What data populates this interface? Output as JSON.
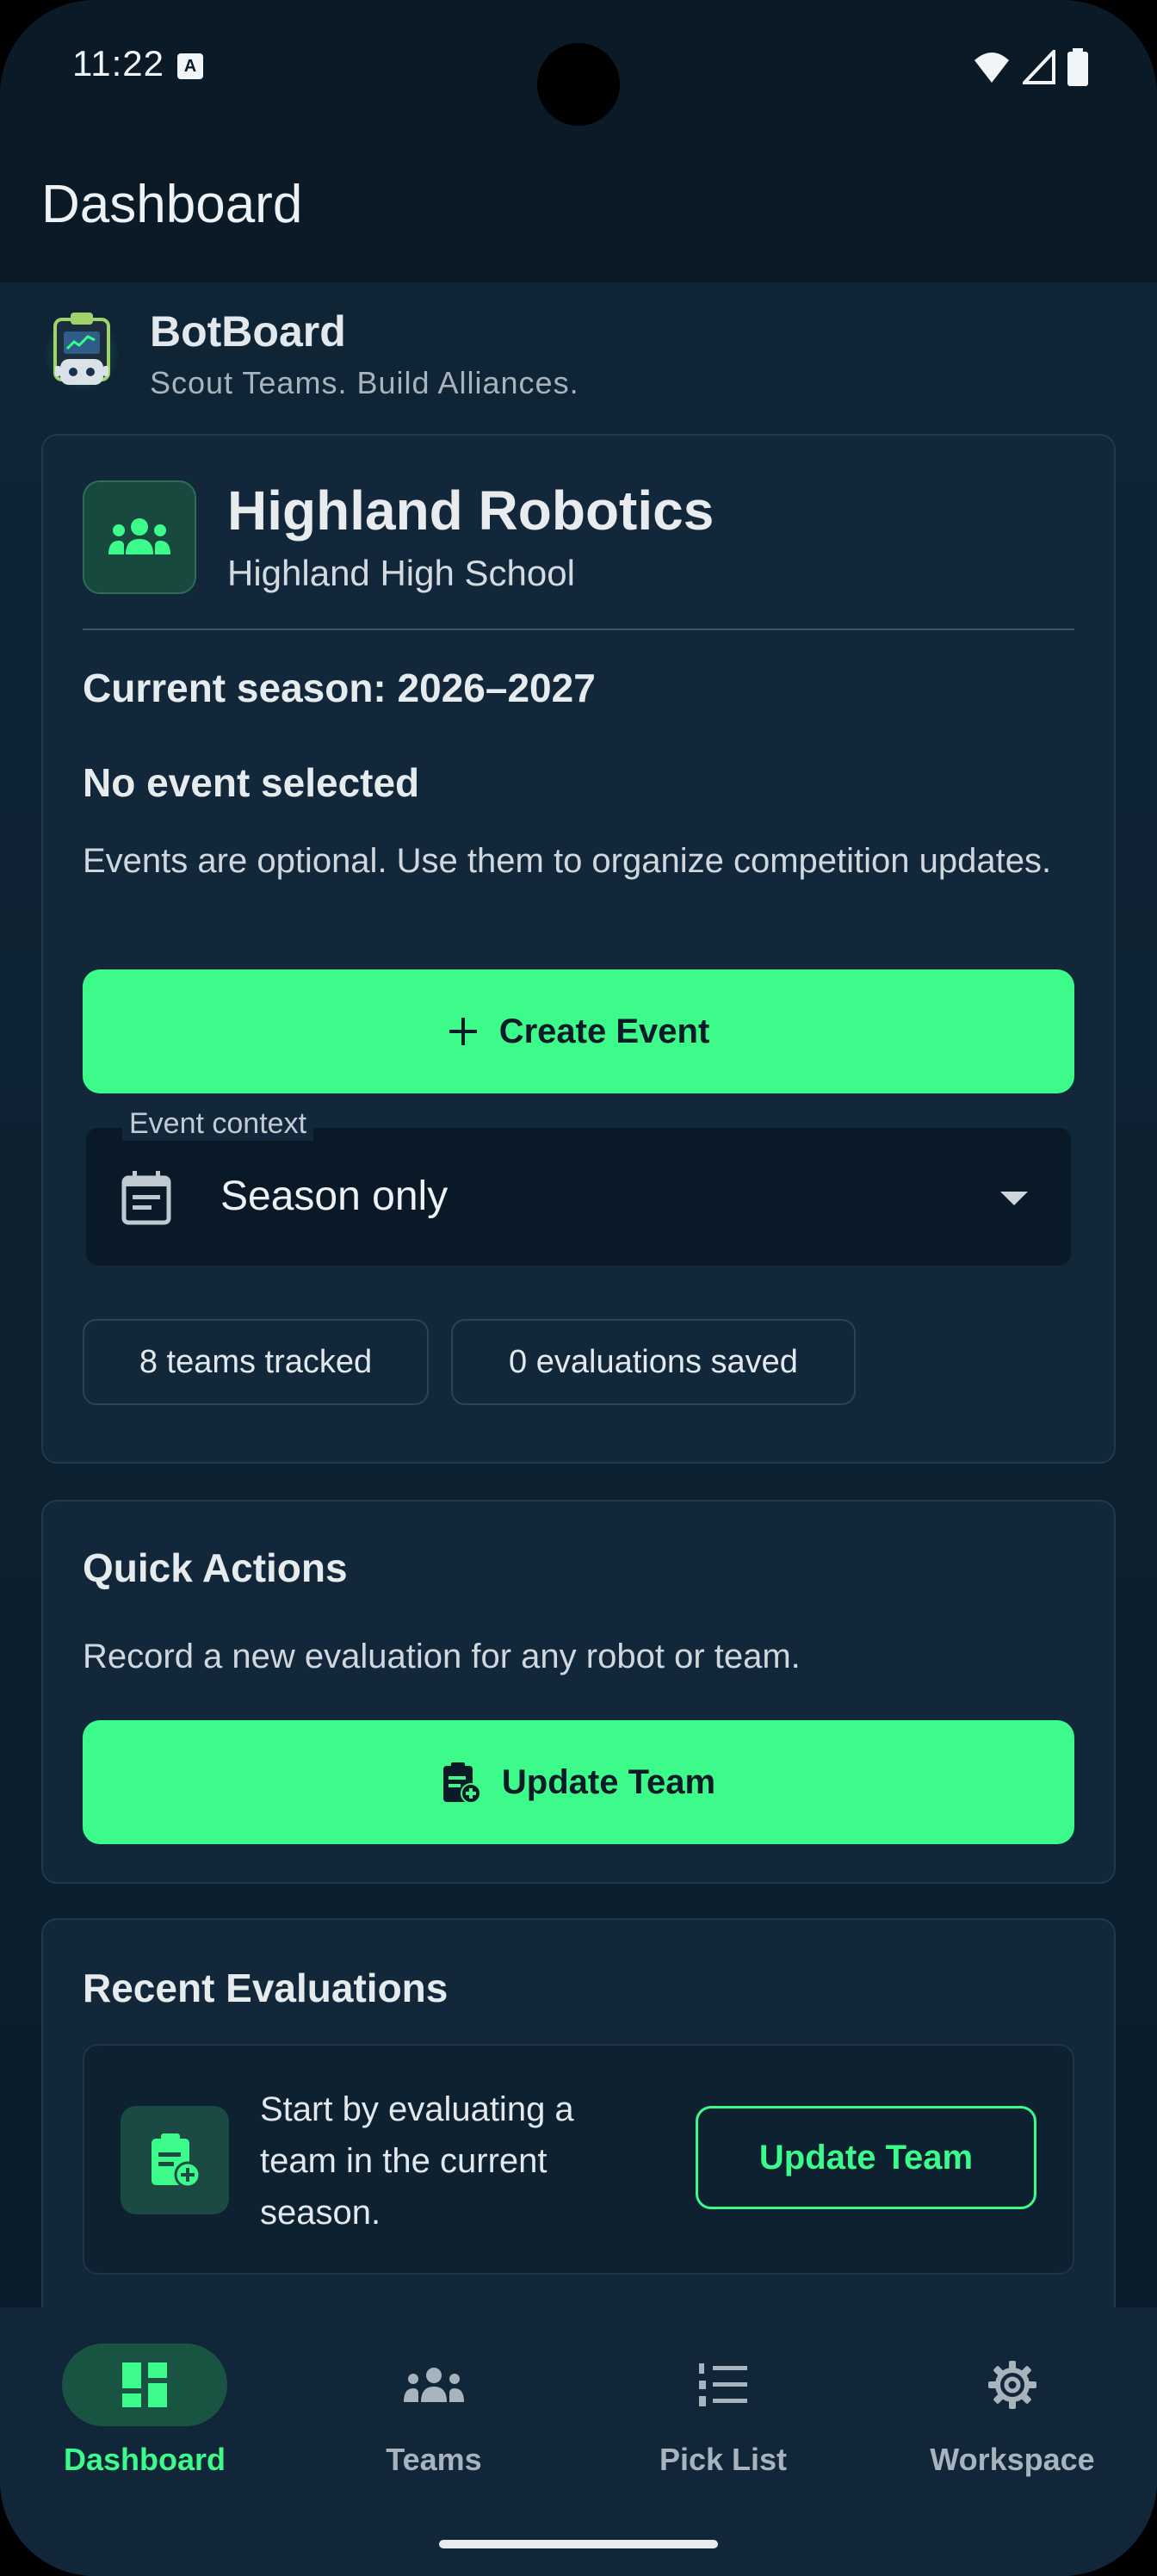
{
  "status_bar": {
    "time": "11:22",
    "indicator": "A"
  },
  "app_bar": {
    "title": "Dashboard"
  },
  "brand": {
    "name": "BotBoard",
    "tagline": "Scout Teams. Build Alliances."
  },
  "team_card": {
    "team_name": "Highland Robotics",
    "school": "Highland High School",
    "season": "Current season: 2026–2027",
    "event_heading": "No event selected",
    "event_description": "Events are optional. Use them to organize competition updates.",
    "create_event_label": "Create Event",
    "event_context_label": "Event context",
    "event_context_value": "Season only",
    "chips": {
      "teams": "8 teams tracked",
      "evaluations": "0 evaluations saved"
    }
  },
  "quick_actions": {
    "title": "Quick Actions",
    "description": "Record a new evaluation for any robot or team.",
    "button_label": "Update Team"
  },
  "recent_evaluations": {
    "title": "Recent Evaluations",
    "empty_text": "Start by evaluating a team in the current season.",
    "button_label": "Update Team"
  },
  "bottom_nav": {
    "items": [
      {
        "label": "Dashboard",
        "icon": "dashboard-icon",
        "active": true
      },
      {
        "label": "Teams",
        "icon": "groups-icon",
        "active": false
      },
      {
        "label": "Pick List",
        "icon": "ranked-list-icon",
        "active": false
      },
      {
        "label": "Workspace",
        "icon": "gear-icon",
        "active": false
      }
    ]
  },
  "colors": {
    "accent": "#3dfb8a",
    "background": "#0b1a27",
    "card": "#12283a"
  }
}
